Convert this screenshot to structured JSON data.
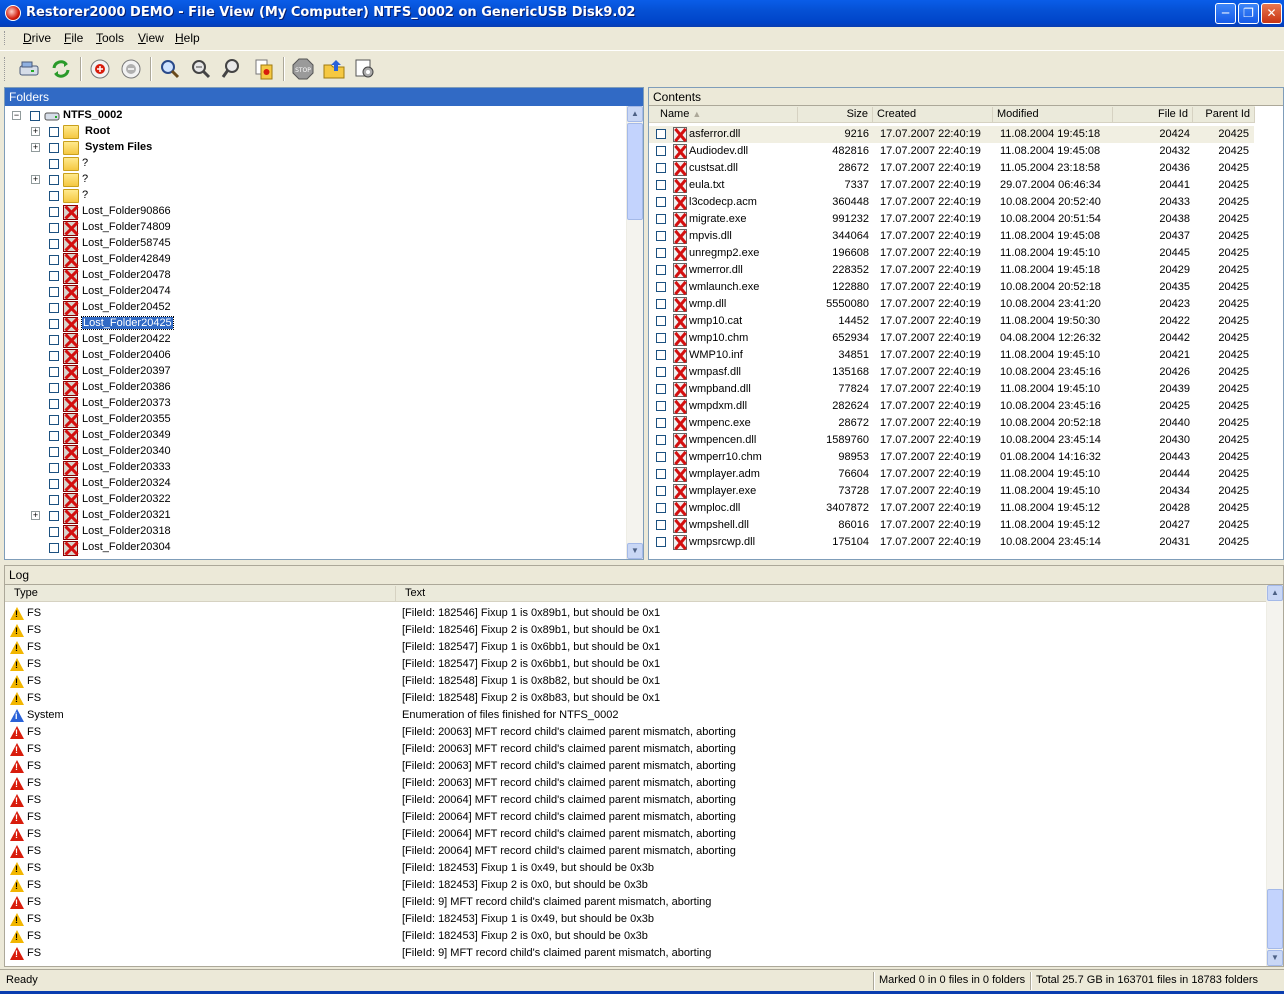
{
  "window": {
    "title": "Restorer2000 DEMO - File View (My Computer) NTFS_0002 on GenericUSB Disk9.02",
    "buttons": [
      "minimize",
      "maximize",
      "close"
    ]
  },
  "menu": [
    "Drive",
    "File",
    "Tools",
    "View",
    "Help"
  ],
  "toolbar": {
    "icons": [
      "drive-connect-icon",
      "refresh-icon",
      "mark-add-icon",
      "mark-remove-icon",
      "find-icon",
      "find-next-icon",
      "find-mark-icon",
      "copy-files-icon",
      "stop-icon",
      "recover-icon",
      "options-icon"
    ]
  },
  "folders": {
    "header": "Folders",
    "root": "NTFS_0002",
    "items": [
      {
        "label": "Root",
        "bold": true,
        "kind": "folder",
        "expand": "+"
      },
      {
        "label": "System Files",
        "bold": true,
        "kind": "folder",
        "expand": "+"
      },
      {
        "label": "?",
        "kind": "folder",
        "expand": ""
      },
      {
        "label": "?",
        "kind": "folder",
        "expand": "+"
      },
      {
        "label": "?",
        "kind": "folder",
        "expand": ""
      },
      {
        "label": "Lost_Folder90866",
        "kind": "lost"
      },
      {
        "label": "Lost_Folder74809",
        "kind": "lost"
      },
      {
        "label": "Lost_Folder58745",
        "kind": "lost"
      },
      {
        "label": "Lost_Folder42849",
        "kind": "lost"
      },
      {
        "label": "Lost_Folder20478",
        "kind": "lost"
      },
      {
        "label": "Lost_Folder20474",
        "kind": "lost"
      },
      {
        "label": "Lost_Folder20452",
        "kind": "lost"
      },
      {
        "label": "Lost_Folder20425",
        "kind": "lost",
        "selected": true
      },
      {
        "label": "Lost_Folder20422",
        "kind": "lost"
      },
      {
        "label": "Lost_Folder20406",
        "kind": "lost"
      },
      {
        "label": "Lost_Folder20397",
        "kind": "lost"
      },
      {
        "label": "Lost_Folder20386",
        "kind": "lost"
      },
      {
        "label": "Lost_Folder20373",
        "kind": "lost"
      },
      {
        "label": "Lost_Folder20355",
        "kind": "lost"
      },
      {
        "label": "Lost_Folder20349",
        "kind": "lost"
      },
      {
        "label": "Lost_Folder20340",
        "kind": "lost"
      },
      {
        "label": "Lost_Folder20333",
        "kind": "lost"
      },
      {
        "label": "Lost_Folder20324",
        "kind": "lost"
      },
      {
        "label": "Lost_Folder20322",
        "kind": "lost"
      },
      {
        "label": "Lost_Folder20321",
        "kind": "lost",
        "expand": "+"
      },
      {
        "label": "Lost_Folder20318",
        "kind": "lost"
      },
      {
        "label": "Lost_Folder20304",
        "kind": "lost"
      }
    ]
  },
  "contents": {
    "header": "Contents",
    "columns": [
      "Name",
      "Size",
      "Created",
      "Modified",
      "File Id",
      "Parent Id"
    ],
    "rows": [
      [
        "asferror.dll",
        "9216",
        "17.07.2007 22:40:19",
        "11.08.2004 19:45:18",
        "20424",
        "20425"
      ],
      [
        "Audiodev.dll",
        "482816",
        "17.07.2007 22:40:19",
        "11.08.2004 19:45:08",
        "20432",
        "20425"
      ],
      [
        "custsat.dll",
        "28672",
        "17.07.2007 22:40:19",
        "11.05.2004 23:18:58",
        "20436",
        "20425"
      ],
      [
        "eula.txt",
        "7337",
        "17.07.2007 22:40:19",
        "29.07.2004 06:46:34",
        "20441",
        "20425"
      ],
      [
        "l3codecp.acm",
        "360448",
        "17.07.2007 22:40:19",
        "10.08.2004 20:52:40",
        "20433",
        "20425"
      ],
      [
        "migrate.exe",
        "991232",
        "17.07.2007 22:40:19",
        "10.08.2004 20:51:54",
        "20438",
        "20425"
      ],
      [
        "mpvis.dll",
        "344064",
        "17.07.2007 22:40:19",
        "11.08.2004 19:45:08",
        "20437",
        "20425"
      ],
      [
        "unregmp2.exe",
        "196608",
        "17.07.2007 22:40:19",
        "11.08.2004 19:45:10",
        "20445",
        "20425"
      ],
      [
        "wmerror.dll",
        "228352",
        "17.07.2007 22:40:19",
        "11.08.2004 19:45:18",
        "20429",
        "20425"
      ],
      [
        "wmlaunch.exe",
        "122880",
        "17.07.2007 22:40:19",
        "10.08.2004 20:52:18",
        "20435",
        "20425"
      ],
      [
        "wmp.dll",
        "5550080",
        "17.07.2007 22:40:19",
        "10.08.2004 23:41:20",
        "20423",
        "20425"
      ],
      [
        "wmp10.cat",
        "14452",
        "17.07.2007 22:40:19",
        "11.08.2004 19:50:30",
        "20422",
        "20425"
      ],
      [
        "wmp10.chm",
        "652934",
        "17.07.2007 22:40:19",
        "04.08.2004 12:26:32",
        "20442",
        "20425"
      ],
      [
        "WMP10.inf",
        "34851",
        "17.07.2007 22:40:19",
        "11.08.2004 19:45:10",
        "20421",
        "20425"
      ],
      [
        "wmpasf.dll",
        "135168",
        "17.07.2007 22:40:19",
        "10.08.2004 23:45:16",
        "20426",
        "20425"
      ],
      [
        "wmpband.dll",
        "77824",
        "17.07.2007 22:40:19",
        "11.08.2004 19:45:10",
        "20439",
        "20425"
      ],
      [
        "wmpdxm.dll",
        "282624",
        "17.07.2007 22:40:19",
        "10.08.2004 23:45:16",
        "20425",
        "20425"
      ],
      [
        "wmpenc.exe",
        "28672",
        "17.07.2007 22:40:19",
        "10.08.2004 20:52:18",
        "20440",
        "20425"
      ],
      [
        "wmpencen.dll",
        "1589760",
        "17.07.2007 22:40:19",
        "10.08.2004 23:45:14",
        "20430",
        "20425"
      ],
      [
        "wmperr10.chm",
        "98953",
        "17.07.2007 22:40:19",
        "01.08.2004 14:16:32",
        "20443",
        "20425"
      ],
      [
        "wmplayer.adm",
        "76604",
        "17.07.2007 22:40:19",
        "11.08.2004 19:45:10",
        "20444",
        "20425"
      ],
      [
        "wmplayer.exe",
        "73728",
        "17.07.2007 22:40:19",
        "11.08.2004 19:45:10",
        "20434",
        "20425"
      ],
      [
        "wmploc.dll",
        "3407872",
        "17.07.2007 22:40:19",
        "11.08.2004 19:45:12",
        "20428",
        "20425"
      ],
      [
        "wmpshell.dll",
        "86016",
        "17.07.2007 22:40:19",
        "11.08.2004 19:45:12",
        "20427",
        "20425"
      ],
      [
        "wmpsrcwp.dll",
        "175104",
        "17.07.2007 22:40:19",
        "10.08.2004 23:45:14",
        "20431",
        "20425"
      ]
    ]
  },
  "log": {
    "header": "Log",
    "columns": [
      "Type",
      "Text"
    ],
    "rows": [
      {
        "level": "warn",
        "type": "FS",
        "text": "[FileId: 182546] Fixup 1 is 0x89b1, but should be 0x1"
      },
      {
        "level": "warn",
        "type": "FS",
        "text": "[FileId: 182546] Fixup 2 is 0x89b1, but should be 0x1"
      },
      {
        "level": "warn",
        "type": "FS",
        "text": "[FileId: 182547] Fixup 1 is 0x6bb1, but should be 0x1"
      },
      {
        "level": "warn",
        "type": "FS",
        "text": "[FileId: 182547] Fixup 2 is 0x6bb1, but should be 0x1"
      },
      {
        "level": "warn",
        "type": "FS",
        "text": "[FileId: 182548] Fixup 1 is 0x8b82, but should be 0x1"
      },
      {
        "level": "warn",
        "type": "FS",
        "text": "[FileId: 182548] Fixup 2 is 0x8b83, but should be 0x1"
      },
      {
        "level": "info",
        "type": "System",
        "text": "Enumeration of files finished for NTFS_0002"
      },
      {
        "level": "err",
        "type": "FS",
        "text": "[FileId: 20063] MFT record child's claimed parent mismatch, aborting"
      },
      {
        "level": "err",
        "type": "FS",
        "text": "[FileId: 20063] MFT record child's claimed parent mismatch, aborting"
      },
      {
        "level": "err",
        "type": "FS",
        "text": "[FileId: 20063] MFT record child's claimed parent mismatch, aborting"
      },
      {
        "level": "err",
        "type": "FS",
        "text": "[FileId: 20063] MFT record child's claimed parent mismatch, aborting"
      },
      {
        "level": "err",
        "type": "FS",
        "text": "[FileId: 20064] MFT record child's claimed parent mismatch, aborting"
      },
      {
        "level": "err",
        "type": "FS",
        "text": "[FileId: 20064] MFT record child's claimed parent mismatch, aborting"
      },
      {
        "level": "err",
        "type": "FS",
        "text": "[FileId: 20064] MFT record child's claimed parent mismatch, aborting"
      },
      {
        "level": "err",
        "type": "FS",
        "text": "[FileId: 20064] MFT record child's claimed parent mismatch, aborting"
      },
      {
        "level": "warn",
        "type": "FS",
        "text": "[FileId: 182453] Fixup 1 is 0x49, but should be 0x3b"
      },
      {
        "level": "warn",
        "type": "FS",
        "text": "[FileId: 182453] Fixup 2 is 0x0, but should be 0x3b"
      },
      {
        "level": "err",
        "type": "FS",
        "text": "[FileId: 9] MFT record child's claimed parent mismatch, aborting"
      },
      {
        "level": "warn",
        "type": "FS",
        "text": "[FileId: 182453] Fixup 1 is 0x49, but should be 0x3b"
      },
      {
        "level": "warn",
        "type": "FS",
        "text": "[FileId: 182453] Fixup 2 is 0x0, but should be 0x3b"
      },
      {
        "level": "err",
        "type": "FS",
        "text": "[FileId: 9] MFT record child's claimed parent mismatch, aborting"
      }
    ]
  },
  "status": {
    "left": "Ready",
    "marked": "Marked 0 in 0 files in 0 folders",
    "total": "Total 25.7 GB in 163701 files in 18783 folders"
  }
}
